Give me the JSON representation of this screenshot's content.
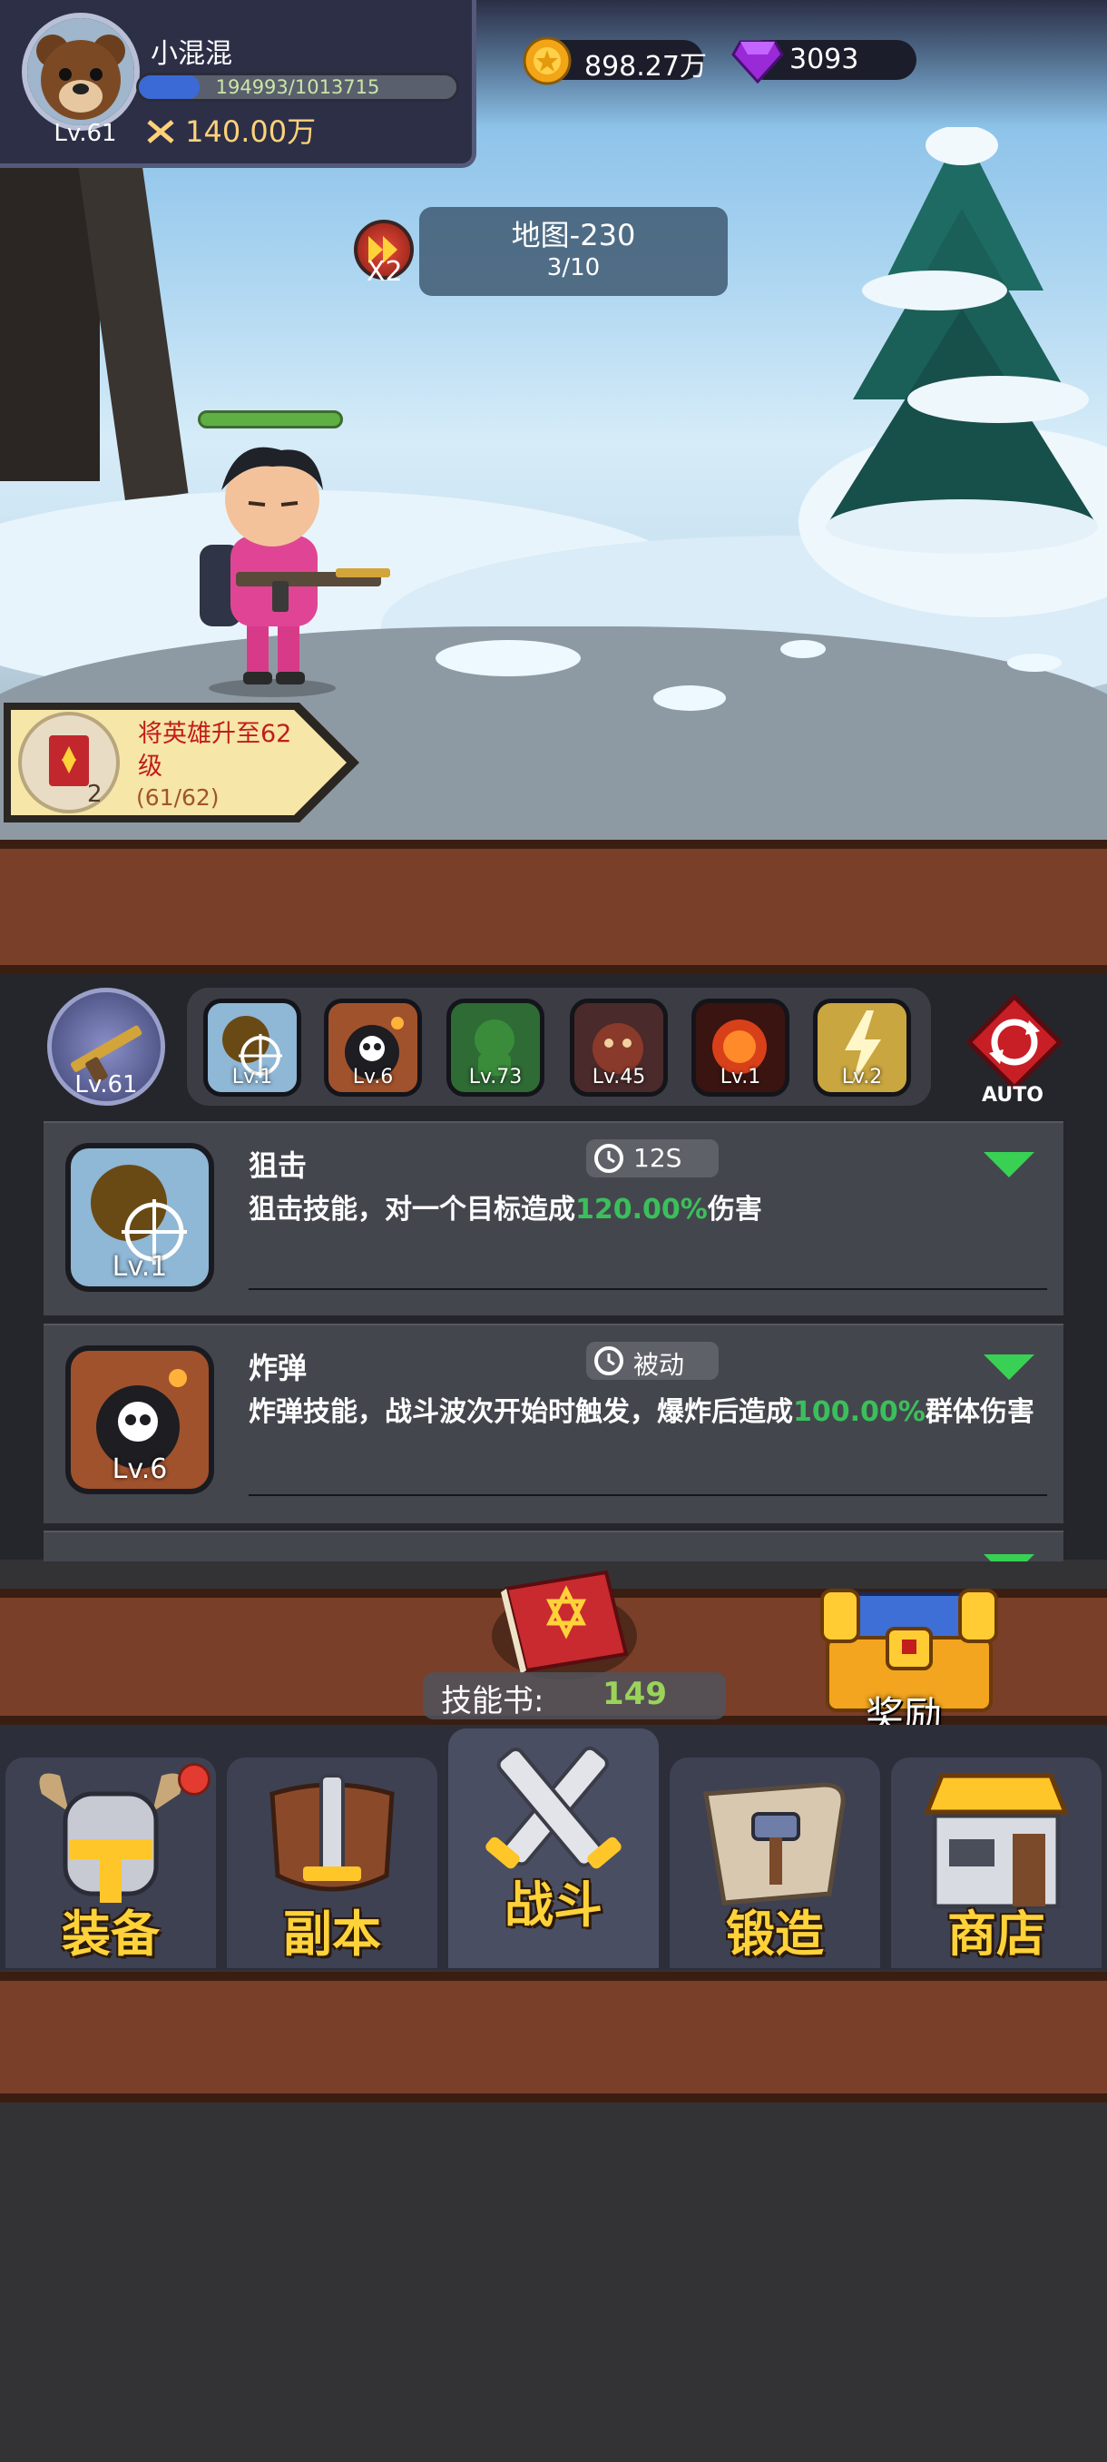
{
  "player": {
    "name": "小混混",
    "level": "Lv.61",
    "exp_text": "194993/1013715",
    "exp_fraction": 0.192,
    "power": "140.00万"
  },
  "currency": {
    "coins": "898.27万",
    "gems": "3093"
  },
  "stage": {
    "map": "地图-230",
    "wave": "3/10",
    "speed": "X2"
  },
  "hero_hp_fraction": 1.0,
  "quest": {
    "title_line1": "将英雄升至62",
    "title_line2": "级",
    "progress": "(61/62)",
    "count": "2"
  },
  "skill_bar": {
    "main_weapon_level": "Lv.61",
    "slots": [
      {
        "name": "sniper-skill",
        "level": "Lv.1"
      },
      {
        "name": "bomb-skill",
        "level": "Lv.6"
      },
      {
        "name": "poison-skill",
        "level": "Lv.73"
      },
      {
        "name": "beast-skill",
        "level": "Lv.45"
      },
      {
        "name": "fire-skill",
        "level": "Lv.1"
      },
      {
        "name": "lightning-skill",
        "level": "Lv.2"
      }
    ],
    "auto_label": "AUTO"
  },
  "skills": [
    {
      "name": "狙击",
      "level": "Lv.1",
      "cooldown": "12S",
      "desc_before": "狙击技能，对一个目标造成",
      "desc_value": "120.00%",
      "desc_after": "伤害"
    },
    {
      "name": "炸弹",
      "level": "Lv.6",
      "cooldown": "被动",
      "desc_before": "炸弹技能，战斗波次开始时触发，爆炸后造成",
      "desc_value": "100.00%",
      "desc_after": "群体伤害"
    }
  ],
  "skill_book": {
    "label": "技能书:",
    "count": "149"
  },
  "reward": {
    "label": "奖励"
  },
  "nav": [
    {
      "label": "装备"
    },
    {
      "label": "副本"
    },
    {
      "label": "战斗"
    },
    {
      "label": "锻造"
    },
    {
      "label": "商店"
    }
  ],
  "colors": {
    "accent_green": "#3bbf5b",
    "nav_text": "#ffd23a",
    "wood": "#7a3f28"
  }
}
